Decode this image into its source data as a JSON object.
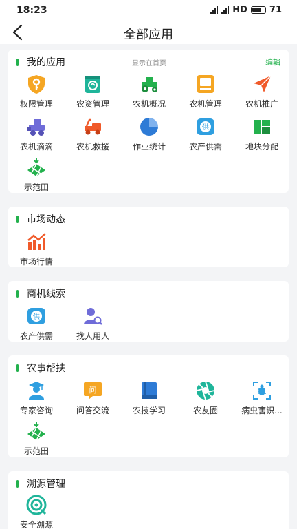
{
  "status_bar": {
    "time": "18:23",
    "network": "HD",
    "battery": "71"
  },
  "nav": {
    "title": "全部应用"
  },
  "sections": {
    "my_apps": {
      "title": "我的应用",
      "note": "显示在首页",
      "edit": "编辑",
      "items": [
        "权限管理",
        "农资管理",
        "农机概况",
        "农机管理",
        "农机推广",
        "农机滴滴",
        "农机救援",
        "作业统计",
        "农产供需",
        "地块分配",
        "示范田"
      ]
    },
    "market": {
      "title": "市场动态",
      "items": [
        "市场行情"
      ]
    },
    "business": {
      "title": "商机线索",
      "items": [
        "农产供需",
        "找人用人"
      ]
    },
    "assist": {
      "title": "农事帮扶",
      "items": [
        "专家咨询",
        "问答交流",
        "农技学习",
        "农友圈",
        "病虫害识...",
        "示范田"
      ]
    },
    "trace": {
      "title": "溯源管理",
      "items": [
        "安全溯源"
      ]
    }
  },
  "icons": {
    "permission": "key-shield-icon",
    "supplies": "supplies-bag-icon",
    "tractor": "tractor-icon",
    "machine_mgmt": "machine-screen-icon",
    "promotion": "paper-plane-icon",
    "didi": "harvester-icon",
    "rescue": "tow-truck-icon",
    "stats": "pie-chart-icon",
    "supply_demand": "supply-badge-icon",
    "plot": "plot-map-icon",
    "demo_field": "demo-field-icon",
    "market": "trend-chart-icon",
    "find_people": "person-search-icon",
    "expert": "expert-icon",
    "qa": "qa-bubble-icon",
    "learning": "book-icon",
    "circle": "aperture-icon",
    "pest": "bug-scan-icon",
    "trace": "trace-shield-icon"
  },
  "colors": {
    "accent": "#23b14d",
    "orange": "#f5a623",
    "teal": "#1fb59a",
    "red": "#f05a2a",
    "blue": "#2e7bd6",
    "purple": "#6f6cd8"
  }
}
